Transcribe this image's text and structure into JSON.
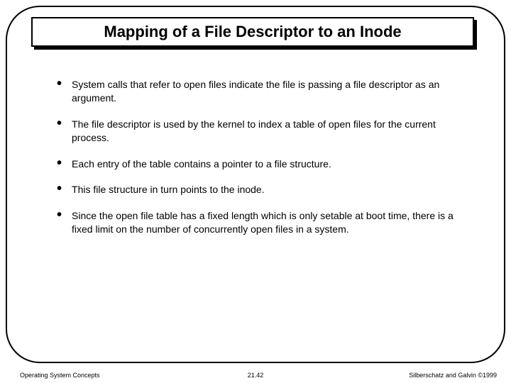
{
  "title": "Mapping of a File Descriptor to an Inode",
  "bullets": [
    "System calls that refer to open files indicate the file is passing a file descriptor as an argument.",
    "The file descriptor is used by the kernel to index a table of open files for the current process.",
    "Each entry of the table contains a pointer to a file structure.",
    "This file structure in turn points to the inode.",
    "Since the open file table has a fixed length which is only setable at boot time, there is a fixed limit on the number of concurrently open files in a system."
  ],
  "footer": {
    "left": "Operating System Concepts",
    "center": "21.42",
    "right": "Silberschatz and Galvin ©1999"
  }
}
